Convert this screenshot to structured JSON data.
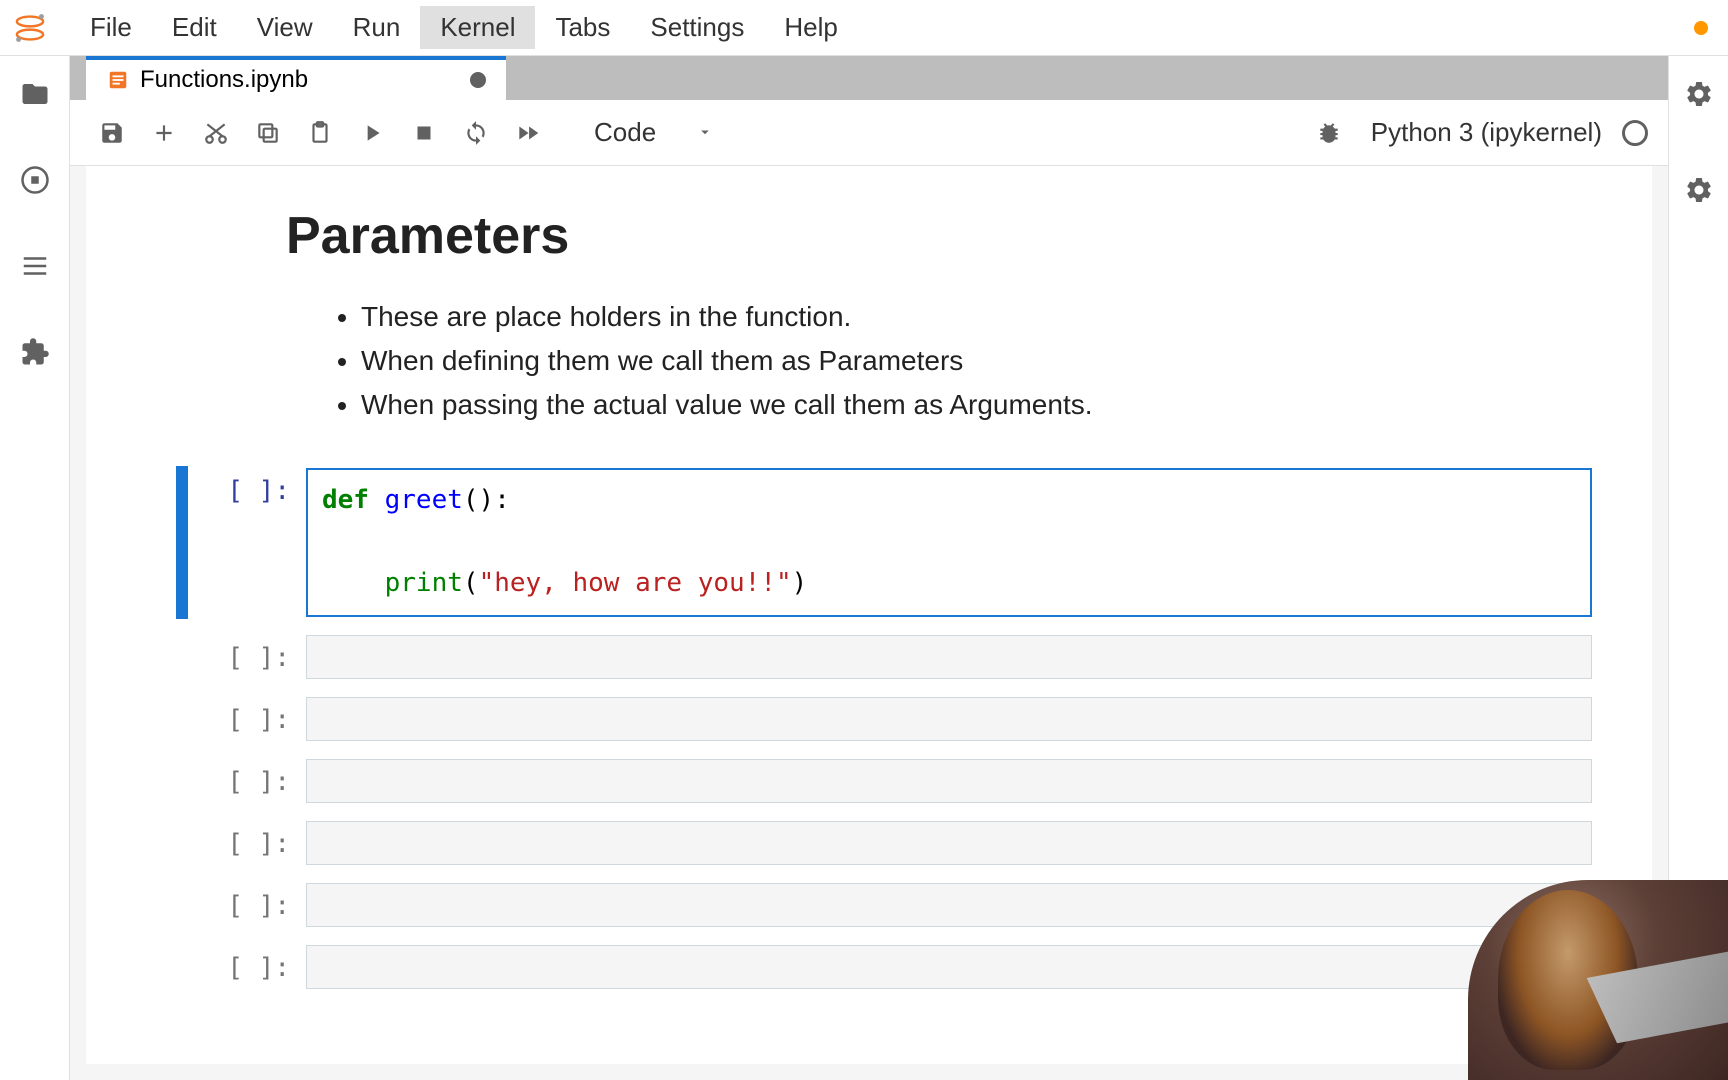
{
  "menubar": {
    "items": [
      "File",
      "Edit",
      "View",
      "Run",
      "Kernel",
      "Tabs",
      "Settings",
      "Help"
    ],
    "active_index": 4
  },
  "tab": {
    "title": "Functions.ipynb",
    "dirty": true
  },
  "toolbar": {
    "cell_type": "Code",
    "kernel_name": "Python 3 (ipykernel)"
  },
  "markdown": {
    "heading": "Parameters",
    "bullets": [
      "These are place holders in the function.",
      "When defining them we call them as Parameters",
      "When passing the actual value we call them as Arguments."
    ]
  },
  "code_cell": {
    "prompt": "[ ]:",
    "tokens": {
      "def": "def",
      "fn": "greet",
      "parens_colon": "():",
      "print": "print",
      "open_paren": "(",
      "string": "\"hey, how are you!!\"",
      "close_paren": ")"
    }
  },
  "empty_cell_prompt": "[ ]:",
  "empty_cell_count": 6
}
